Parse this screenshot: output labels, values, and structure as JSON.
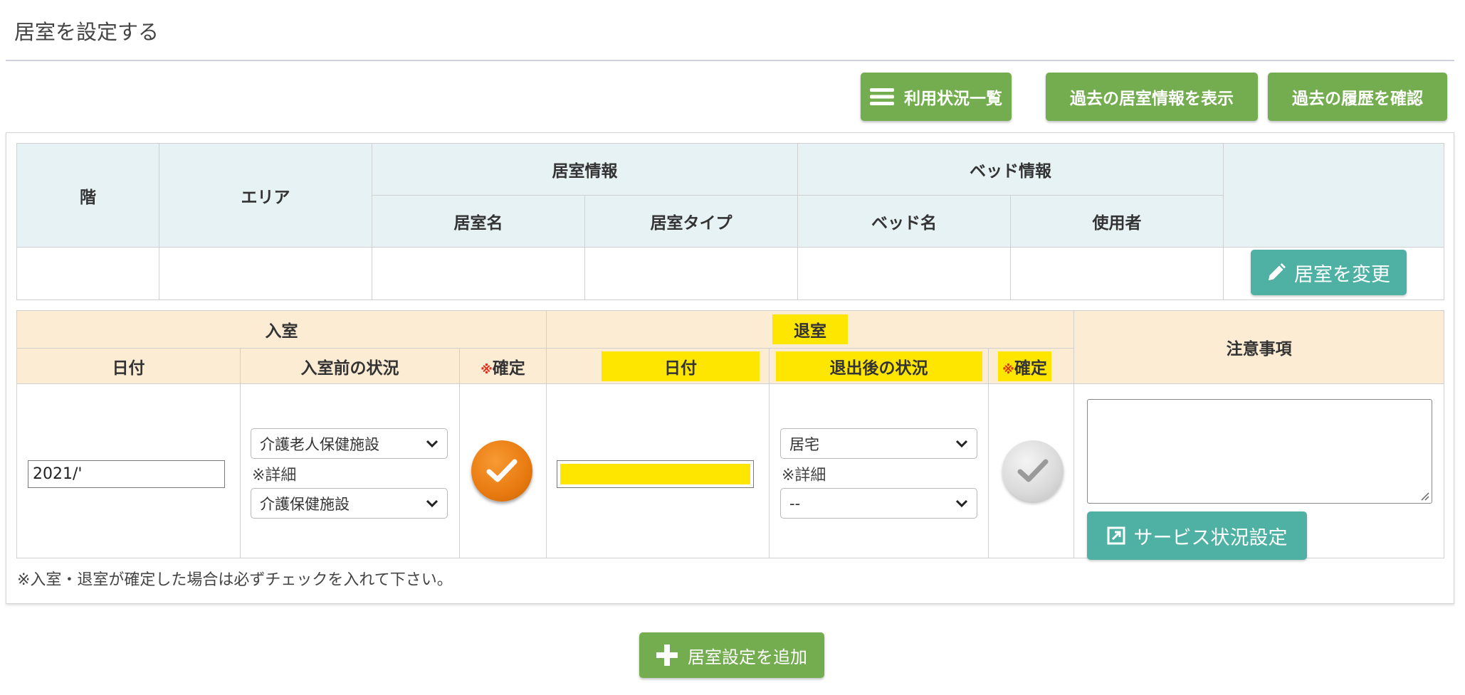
{
  "page": {
    "title": "居室を設定する"
  },
  "toolbar": {
    "usage_list": "利用状況一覧",
    "past_room_info": "過去の居室情報を表示",
    "past_history": "過去の履歴を確認"
  },
  "room_table": {
    "floor": "階",
    "area": "エリア",
    "room_info": "居室情報",
    "bed_info": "ベッド情報",
    "room_name": "居室名",
    "room_type": "居室タイプ",
    "bed_name": "ベッド名",
    "user": "使用者",
    "change_button": "居室を変更"
  },
  "stay": {
    "admission": "入室",
    "discharge": "退室",
    "date": "日付",
    "before_status": "入室前の状況",
    "after_status": "退出後の状況",
    "confirm_mark": "※",
    "confirm": "確定",
    "notes": "注意事項",
    "admission_date_value": "2021/'",
    "before_select": "介護老人保健施設",
    "detail_label": "※詳細",
    "before_detail_select": "介護保健施設",
    "after_select": "居宅",
    "after_detail_select": "--",
    "service_button": "サービス状況設定"
  },
  "footer_note": "※入室・退室が確定した場合は必ずチェックを入れて下さい。",
  "add_button": "居室設定を追加",
  "colors": {
    "green": "#74ad4f",
    "teal": "#4fb1a3",
    "orange": "#e87a10",
    "highlight": "#ffe600"
  }
}
